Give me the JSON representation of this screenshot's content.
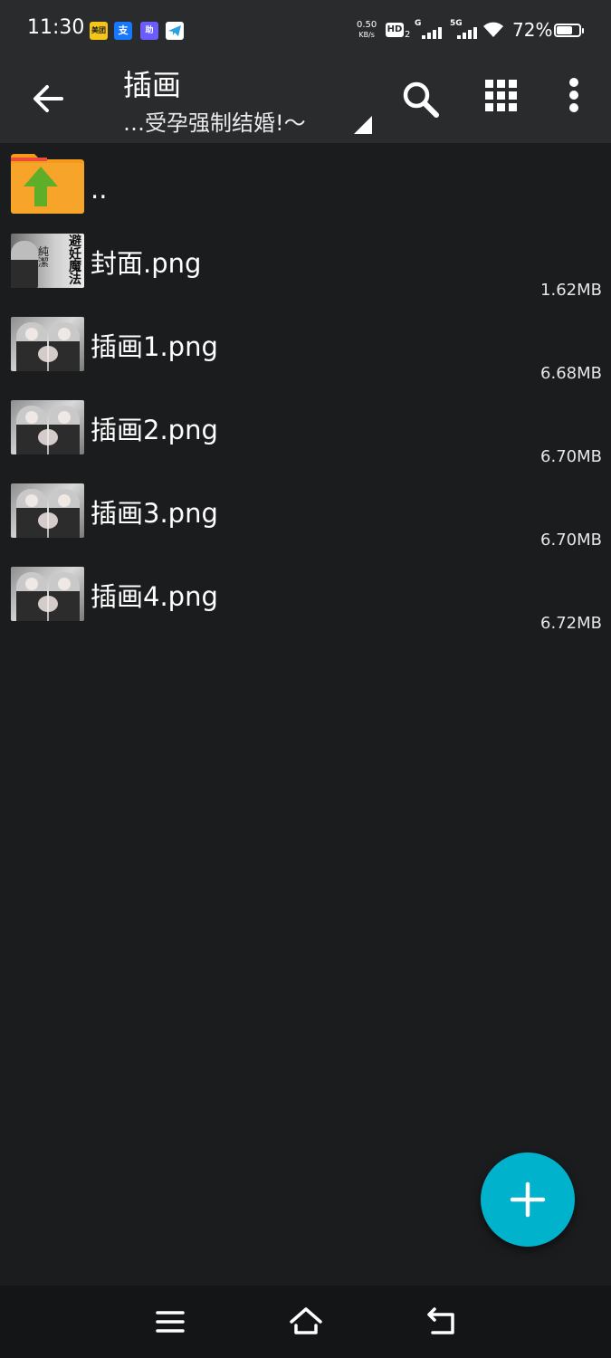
{
  "status_bar": {
    "time": "11:30",
    "net_speed_value": "0.50",
    "net_speed_unit": "KB/s",
    "hd_label": "HD",
    "hd_sub": "2",
    "signal1_label": "G",
    "signal2_label": "5G",
    "battery_percent": "72%",
    "battery_level": 0.72,
    "notification_icons": [
      "meituan-icon",
      "alipay-icon",
      "app-icon",
      "telegram-icon"
    ]
  },
  "app_bar": {
    "title": "插画",
    "subtitle": "…受孕强制结婚!～"
  },
  "files": [
    {
      "name": "..",
      "size": "",
      "type": "parent-folder"
    },
    {
      "name": "封面.png",
      "size": "1.62MB",
      "type": "cover-image"
    },
    {
      "name": "插画1.png",
      "size": "6.68MB",
      "type": "image"
    },
    {
      "name": "插画2.png",
      "size": "6.70MB",
      "type": "image"
    },
    {
      "name": "插画3.png",
      "size": "6.70MB",
      "type": "image"
    },
    {
      "name": "插画4.png",
      "size": "6.72MB",
      "type": "image"
    }
  ],
  "cover_thumb_text": {
    "right": "避妊魔法",
    "middle": "純潔"
  },
  "colors": {
    "background": "#1b1c1e",
    "app_bar": "#2a2b2d",
    "fab": "#00b2cc",
    "folder": "#f59a1b",
    "folder_arrow": "#5fae2a"
  }
}
